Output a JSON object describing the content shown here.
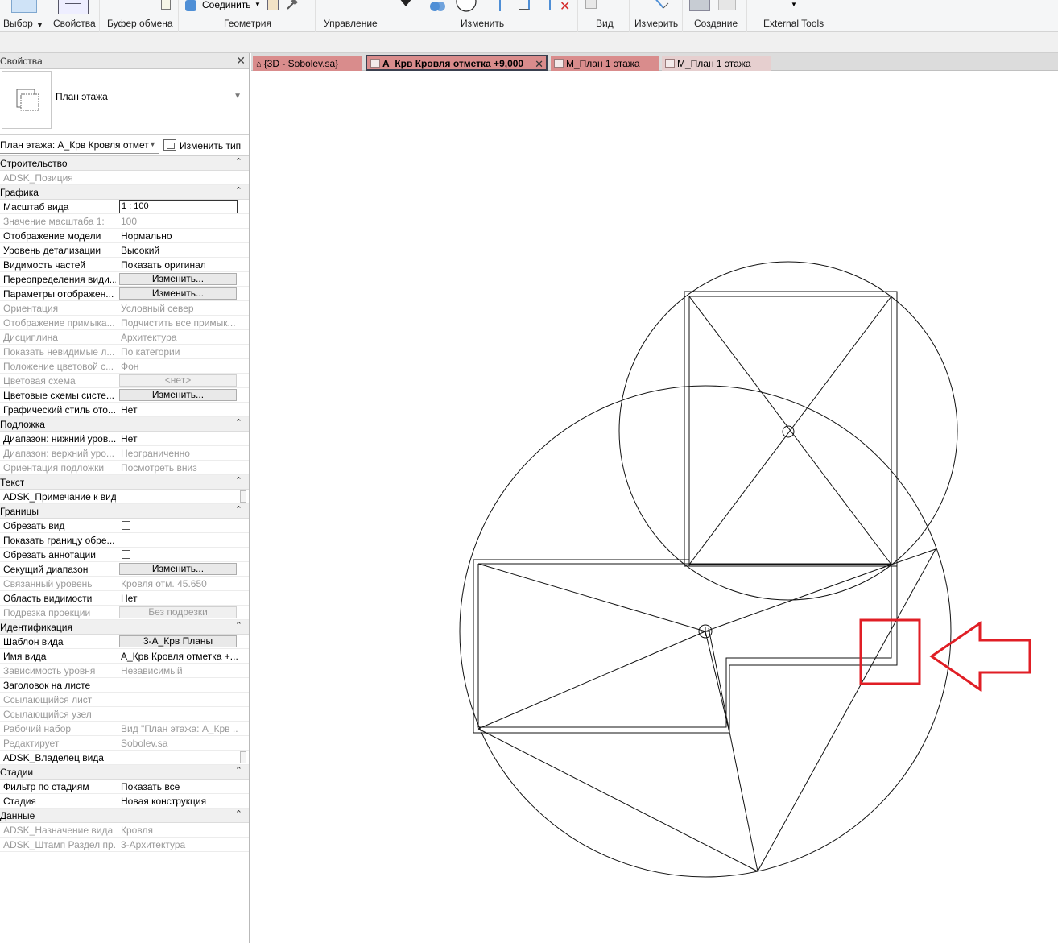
{
  "ribbon": {
    "groups": [
      {
        "id": "select",
        "label": "Выбор"
      },
      {
        "id": "properties",
        "label": "Свойства"
      },
      {
        "id": "clipboard",
        "label": "Буфер обмена"
      },
      {
        "id": "geometry",
        "label": "Геометрия"
      },
      {
        "id": "control",
        "label": "Управление"
      },
      {
        "id": "modify",
        "label": "Изменить"
      },
      {
        "id": "view",
        "label": "Вид"
      },
      {
        "id": "measure",
        "label": "Измерить"
      },
      {
        "id": "create",
        "label": "Создание"
      },
      {
        "id": "external",
        "label": "External Tools"
      }
    ],
    "join_label": "Соединить"
  },
  "properties": {
    "title": "Свойства",
    "type_name": "План этажа",
    "instance_selector": "План этажа: А_Крв Кровля отмет",
    "edit_type": "Изменить тип",
    "categories": [
      {
        "name": "Строительство",
        "rows": [
          {
            "key": "ADSK_Позиция",
            "value": "",
            "kind": "text",
            "disabled": true
          }
        ]
      },
      {
        "name": "Графика",
        "rows": [
          {
            "key": "Масштаб вида",
            "value": "1 : 100",
            "kind": "input",
            "disabled": false
          },
          {
            "key": "Значение масштаба    1:",
            "value": "100",
            "kind": "text",
            "disabled": true
          },
          {
            "key": "Отображение модели",
            "value": "Нормально",
            "kind": "text",
            "disabled": false
          },
          {
            "key": "Уровень детализации",
            "value": "Высокий",
            "kind": "text",
            "disabled": false
          },
          {
            "key": "Видимость частей",
            "value": "Показать оригинал",
            "kind": "text",
            "disabled": false
          },
          {
            "key": "Переопределения види...",
            "value": "Изменить...",
            "kind": "button",
            "disabled": false
          },
          {
            "key": "Параметры отображен...",
            "value": "Изменить...",
            "kind": "button",
            "disabled": false
          },
          {
            "key": "Ориентация",
            "value": "Условный север",
            "kind": "text",
            "disabled": true
          },
          {
            "key": "Отображение примыка...",
            "value": "Подчистить все примык...",
            "kind": "text",
            "disabled": true
          },
          {
            "key": "Дисциплина",
            "value": "Архитектура",
            "kind": "text",
            "disabled": true
          },
          {
            "key": "Показать невидимые л...",
            "value": "По категории",
            "kind": "text",
            "disabled": true
          },
          {
            "key": "Положение цветовой с...",
            "value": "Фон",
            "kind": "text",
            "disabled": true
          },
          {
            "key": "Цветовая схема",
            "value": "<нет>",
            "kind": "button",
            "disabled": true
          },
          {
            "key": "Цветовые схемы систе...",
            "value": "Изменить...",
            "kind": "button",
            "disabled": false
          },
          {
            "key": "Графический стиль ото...",
            "value": "Нет",
            "kind": "text",
            "disabled": false
          }
        ]
      },
      {
        "name": "Подложка",
        "rows": [
          {
            "key": "Диапазон: нижний уров...",
            "value": "Нет",
            "kind": "text",
            "disabled": false
          },
          {
            "key": "Диапазон: верхний уро...",
            "value": "Неограниченно",
            "kind": "text",
            "disabled": true
          },
          {
            "key": "Ориентация подложки",
            "value": "Посмотреть вниз",
            "kind": "text",
            "disabled": true
          }
        ]
      },
      {
        "name": "Текст",
        "rows": [
          {
            "key": "ADSK_Примечание к виду",
            "value": "",
            "kind": "scroll",
            "disabled": false
          }
        ]
      },
      {
        "name": "Границы",
        "rows": [
          {
            "key": "Обрезать вид",
            "value": "",
            "kind": "checkbox",
            "disabled": false
          },
          {
            "key": "Показать границу обре...",
            "value": "",
            "kind": "checkbox",
            "disabled": false
          },
          {
            "key": "Обрезать аннотации",
            "value": "",
            "kind": "checkbox",
            "disabled": false
          },
          {
            "key": "Секущий диапазон",
            "value": "Изменить...",
            "kind": "button",
            "disabled": false
          },
          {
            "key": "Связанный уровень",
            "value": "Кровля отм. 45.650",
            "kind": "text",
            "disabled": true
          },
          {
            "key": "Область видимости",
            "value": "Нет",
            "kind": "text",
            "disabled": false
          },
          {
            "key": "Подрезка проекции",
            "value": "Без подрезки",
            "kind": "button",
            "disabled": true
          }
        ]
      },
      {
        "name": "Идентификация",
        "rows": [
          {
            "key": "Шаблон вида",
            "value": "3-А_Крв Планы",
            "kind": "button",
            "disabled": false
          },
          {
            "key": "Имя вида",
            "value": "А_Крв Кровля отметка +...",
            "kind": "text",
            "disabled": false
          },
          {
            "key": "Зависимость уровня",
            "value": "Независимый",
            "kind": "text",
            "disabled": true
          },
          {
            "key": "Заголовок на листе",
            "value": "",
            "kind": "text",
            "disabled": false
          },
          {
            "key": "Ссылающийся лист",
            "value": "",
            "kind": "text",
            "disabled": true
          },
          {
            "key": "Ссылающийся узел",
            "value": "",
            "kind": "text",
            "disabled": true
          },
          {
            "key": "Рабочий набор",
            "value": "Вид \"План этажа: А_Крв ...",
            "kind": "text",
            "disabled": true
          },
          {
            "key": "Редактирует",
            "value": "Sobolev.sa",
            "kind": "text",
            "disabled": true
          },
          {
            "key": "ADSK_Владелец вида",
            "value": "",
            "kind": "scroll",
            "disabled": false
          }
        ]
      },
      {
        "name": "Стадии",
        "rows": [
          {
            "key": "Фильтр по стадиям",
            "value": "Показать все",
            "kind": "text",
            "disabled": false
          },
          {
            "key": "Стадия",
            "value": "Новая конструкция",
            "kind": "text",
            "disabled": false
          }
        ]
      },
      {
        "name": "Данные",
        "rows": [
          {
            "key": "ADSK_Назначение вида",
            "value": "Кровля",
            "kind": "text",
            "disabled": true
          },
          {
            "key": "ADSK_Штамп Раздел пр...",
            "value": "3-Архитектура",
            "kind": "text",
            "disabled": true
          }
        ]
      }
    ]
  },
  "tabs": [
    {
      "label": "{3D - Sobolev.sa}",
      "active": false,
      "color": "#d98c8c"
    },
    {
      "label": "А_Крв Кровля отметка +9,000",
      "active": true,
      "color": "#d98c8c"
    },
    {
      "label": "М_План 1 этажа",
      "active": false,
      "color": "#d98c8c"
    },
    {
      "label": "М_План 1 этажа",
      "active": false,
      "color": "#e6cfcf"
    }
  ],
  "colors": {
    "highlight": "#e01e25",
    "tab_red": "#d98c8c"
  }
}
